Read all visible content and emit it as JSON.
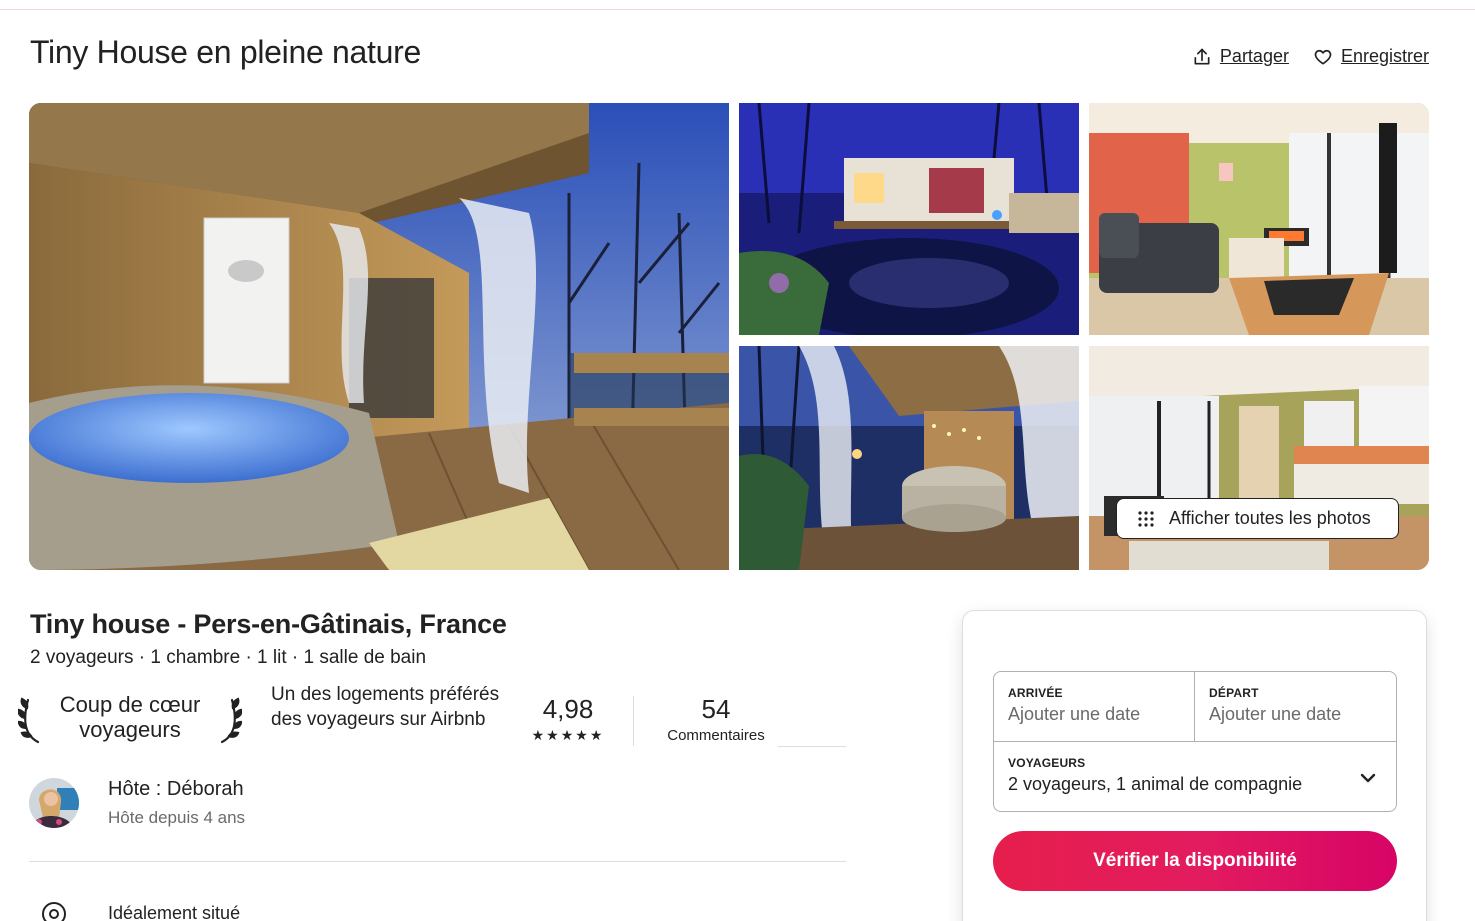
{
  "listing": {
    "title": "Tiny House en pleine nature",
    "subtitle": "Tiny house - Pers-en-Gâtinais, France",
    "specs": "2 voyageurs · 1 chambre · 1 lit · 1 salle de bain"
  },
  "actions": {
    "share_label": "Partager",
    "save_label": "Enregistrer"
  },
  "gallery": {
    "show_all_label": "Afficher toutes les photos"
  },
  "guest_favorite": {
    "badge": "Coup de cœur voyageurs",
    "description": "Un des logements préférés des voyageurs sur Airbnb",
    "rating": "4,98",
    "stars": "★★★★★",
    "reviews_count": "54",
    "reviews_label": "Commentaires"
  },
  "host": {
    "name": "Hôte : Déborah",
    "since": "Hôte depuis 4 ans"
  },
  "highlight": {
    "location_label": "Idéalement situé"
  },
  "booking": {
    "checkin_label": "ARRIVÉE",
    "checkin_placeholder": "Ajouter une date",
    "checkout_label": "DÉPART",
    "checkout_placeholder": "Ajouter une date",
    "guests_label": "VOYAGEURS",
    "guests_value": "2 voyageurs, 1 animal de compagnie",
    "cta_label": "Vérifier la disponibilité"
  },
  "colors": {
    "accent": "#e31c5f",
    "text": "#222222",
    "muted": "#6a6a6a",
    "border": "#dddddd"
  }
}
